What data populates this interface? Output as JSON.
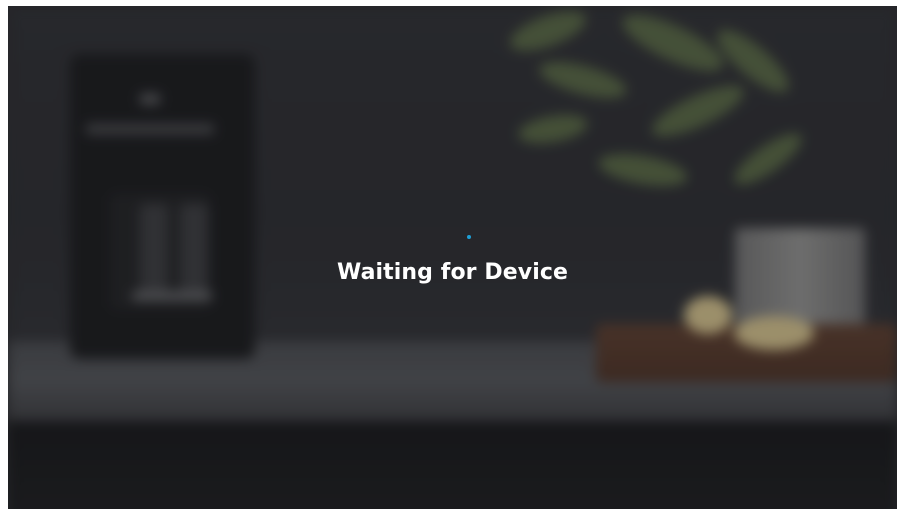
{
  "status": {
    "message": "Waiting for Device",
    "spinner_color": "#1e9fd6"
  },
  "background": {
    "description_icon": "kitchen-background-image"
  }
}
